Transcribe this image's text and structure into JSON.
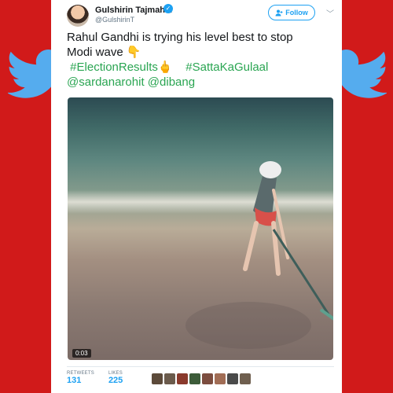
{
  "author": {
    "name": "Gulshirin Tajmahal",
    "handle": "@GulshirinT",
    "avatar": "avatar"
  },
  "follow_button": {
    "label": "Follow",
    "icon": "add-user-icon"
  },
  "tweet": {
    "line1": "Rahul Gandhi is trying his level best to stop",
    "line2_text": "Modi wave",
    "line2_emoji": "👇",
    "hashtag1": "#ElectionResults",
    "hashtag1_emoji": "🖕",
    "hashtag2": "#SattaKaGulaal",
    "mention1": "@sardanarohit",
    "mention2": "@dibang"
  },
  "video": {
    "timecode": "0:03"
  },
  "stats": {
    "retweets_label": "RETWEETS",
    "retweets_value": "131",
    "likes_label": "LIKES",
    "likes_value": "225"
  },
  "colors": {
    "background": "#d11a1a",
    "link": "#1da1f2",
    "hashtag": "#2aa552",
    "bird": "#55acee"
  },
  "likers": [
    "#5c4a3a",
    "#6b5b4c",
    "#8a3a2c",
    "#3d5c3a",
    "#7c4d3f",
    "#a16d55",
    "#4a4a4a",
    "#6f5f4f"
  ]
}
